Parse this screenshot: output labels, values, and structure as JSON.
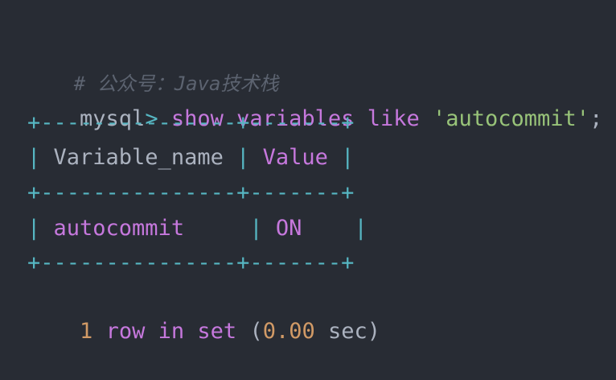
{
  "comment": "# 公众号：Java技术栈",
  "command": {
    "prompt": "mysql",
    "prompt_symbol": "> ",
    "keyword1": "show",
    "keyword2": "variables",
    "keyword3": "like",
    "string": "'autocommit'",
    "terminator": ";"
  },
  "table": {
    "separator": "+---------------+-------+",
    "headers": [
      "Variable_name",
      "Value"
    ],
    "rows": [
      [
        "autocommit",
        "ON"
      ]
    ]
  },
  "result": {
    "count": "1",
    "text1": "row",
    "text2": "in",
    "text3": "set",
    "open_paren": "(",
    "time": "0.00",
    "unit": "sec",
    "close_paren": ")"
  }
}
